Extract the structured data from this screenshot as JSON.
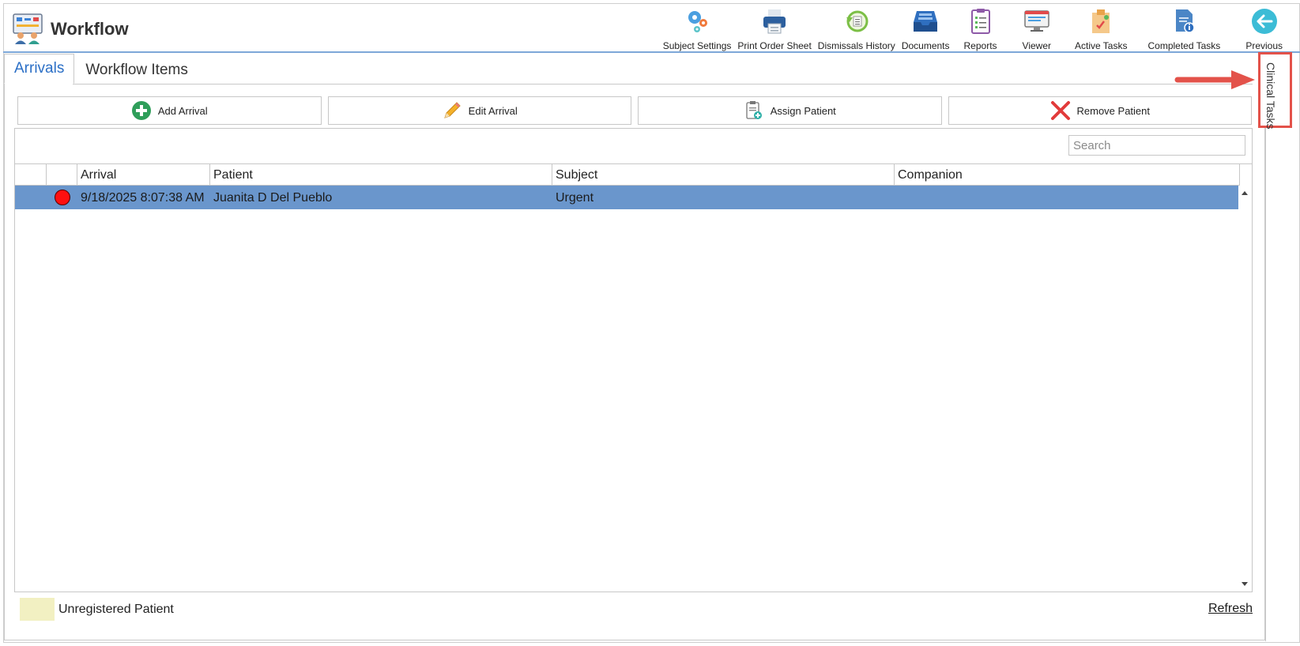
{
  "app": {
    "title": "Workflow"
  },
  "toolbar": [
    {
      "label": "Subject Settings",
      "icon": "gears-icon"
    },
    {
      "label": "Print Order Sheet",
      "icon": "printer-icon"
    },
    {
      "label": "Dismissals History",
      "icon": "history-icon"
    },
    {
      "label": "Documents",
      "icon": "inbox-tray-icon"
    },
    {
      "label": "Reports",
      "icon": "report-clipboard-icon"
    },
    {
      "label": "Viewer",
      "icon": "monitor-icon"
    },
    {
      "label": "Active Tasks",
      "icon": "active-tasks-icon"
    },
    {
      "label": "Completed Tasks",
      "icon": "completed-tasks-icon"
    },
    {
      "label": "Previous",
      "icon": "back-arrow-icon"
    }
  ],
  "tabs": [
    {
      "label": "Arrivals",
      "active": true
    },
    {
      "label": "Workflow Items",
      "active": false
    }
  ],
  "actions": [
    {
      "label": "Add Arrival",
      "icon": "plus-circle-icon"
    },
    {
      "label": "Edit Arrival",
      "icon": "pencil-icon"
    },
    {
      "label": "Assign Patient",
      "icon": "clipboard-add-icon"
    },
    {
      "label": "Remove Patient",
      "icon": "red-x-icon"
    }
  ],
  "search": {
    "placeholder": "Search",
    "value": ""
  },
  "table": {
    "columns": [
      "",
      "",
      "Arrival",
      "Patient",
      "Subject",
      "Companion"
    ],
    "rows": [
      {
        "status": "red",
        "arrival": "9/18/2025 8:07:38 AM",
        "patient": "Juanita D Del Pueblo",
        "subject": "Urgent",
        "companion": "",
        "selected": true
      }
    ]
  },
  "legend": {
    "label": "Unregistered Patient",
    "color": "#f2f0c2"
  },
  "refresh_label": "Refresh",
  "side_panel": {
    "label": "Clinical Tasks"
  },
  "colors": {
    "accent": "#2b6fc6",
    "selected_row": "#6a96cc",
    "highlight": "#e3524a"
  }
}
